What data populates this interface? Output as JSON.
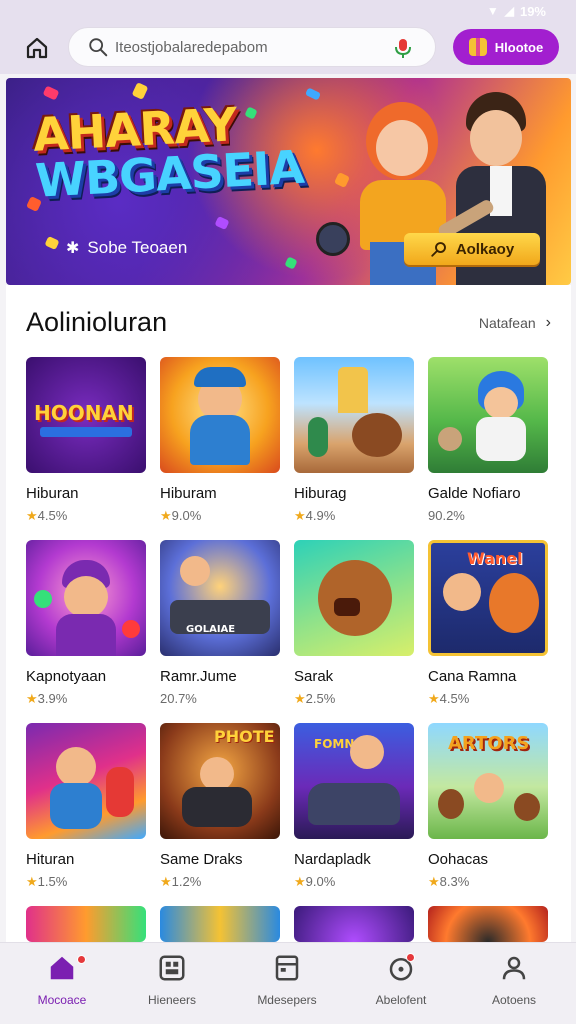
{
  "status_bar": {
    "battery": "19%"
  },
  "top_bar": {
    "search_placeholder": "Iteostjobalaredepabom",
    "promo_label": "Hlootoe"
  },
  "banner": {
    "title_line1": "AHARAY",
    "title_line2": "WBGASEIA",
    "subtitle": "Sobe Teoaen",
    "button_label": "Aolkaoy"
  },
  "section": {
    "title": "Aolinioluran",
    "see_all": "Natafean"
  },
  "games": [
    {
      "name": "Hiburan",
      "rating": "★4.5%",
      "art": "HOONAN"
    },
    {
      "name": "Hiburam",
      "rating": "★9.0%",
      "art": ""
    },
    {
      "name": "Hiburag",
      "rating": "★4.9%",
      "art": ""
    },
    {
      "name": "Galde Nofiaro",
      "rating": "90.2%",
      "art": ""
    },
    {
      "name": "Kapnotyaan",
      "rating": "★3.9%",
      "art": ""
    },
    {
      "name": "Ramr.Jume",
      "rating": "20.7%",
      "art": "GOLAIAE"
    },
    {
      "name": "Sarak",
      "rating": "★2.5%",
      "art": ""
    },
    {
      "name": "Cana Ramna",
      "rating": "★4.5%",
      "art": "Wanel"
    },
    {
      "name": "Hituran",
      "rating": "★1.5%",
      "art": ""
    },
    {
      "name": "Same Draks",
      "rating": "★1.2%",
      "art": "PHOTE"
    },
    {
      "name": "Nardapladk",
      "rating": "★9.0%",
      "art": "FOMNA"
    },
    {
      "name": "Oohacas",
      "rating": "★8.3%",
      "art": "ARTORS"
    }
  ],
  "bottom_nav": [
    {
      "label": "Mocoace",
      "icon": "home-icon",
      "active": true
    },
    {
      "label": "Hieneers",
      "icon": "grid-icon",
      "active": false
    },
    {
      "label": "Mdesepers",
      "icon": "calendar-icon",
      "active": false
    },
    {
      "label": "Abelofent",
      "icon": "notification-icon",
      "active": false
    },
    {
      "label": "Aotoens",
      "icon": "profile-icon",
      "active": false
    }
  ],
  "colors": {
    "accent": "#a21fcf",
    "active_nav": "#7b1fb1",
    "star": "#f0a91c"
  }
}
